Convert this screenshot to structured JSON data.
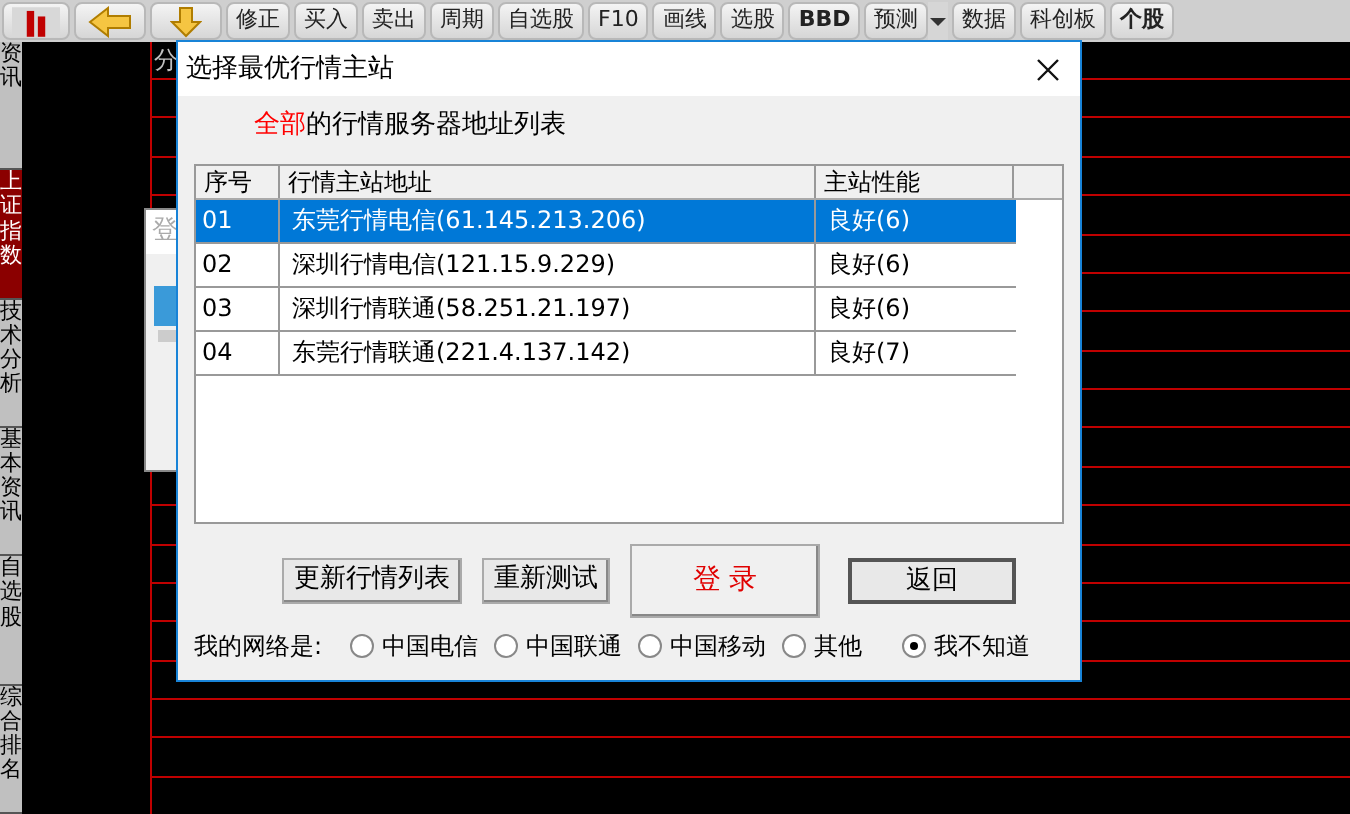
{
  "toolbar": [
    {
      "kind": "icon"
    },
    {
      "kind": "icon"
    },
    {
      "kind": "icon"
    },
    {
      "kind": "text",
      "label": "修正"
    },
    {
      "kind": "text",
      "label": "买入"
    },
    {
      "kind": "text",
      "label": "卖出"
    },
    {
      "kind": "text",
      "label": "周期"
    },
    {
      "kind": "text",
      "label": "自选股"
    },
    {
      "kind": "text",
      "label": "F10"
    },
    {
      "kind": "text",
      "label": "画线"
    },
    {
      "kind": "text",
      "label": "选股"
    },
    {
      "kind": "badge",
      "label": "BBD"
    },
    {
      "kind": "dropdown",
      "label": "预测"
    },
    {
      "kind": "text",
      "label": "数据"
    },
    {
      "kind": "text",
      "label": "科创板"
    },
    {
      "kind": "badge",
      "label": "个股"
    }
  ],
  "sidebar": [
    {
      "label": "资讯",
      "selected": false
    },
    {
      "label": "上证指数",
      "selected": true
    },
    {
      "label": "技术分析",
      "selected": false
    },
    {
      "label": "基本资讯",
      "selected": false
    },
    {
      "label": "自选股",
      "selected": false
    },
    {
      "label": "综合排名",
      "selected": false
    }
  ],
  "chart_header": "分",
  "background_dialog": {
    "title": "登"
  },
  "dialog": {
    "title": "选择最优行情主站",
    "heading": "**全部**的行情服务器地址列表",
    "columns": [
      "序号",
      "行情主站地址",
      "主站性能"
    ],
    "rows": [
      {
        "index": "01",
        "address": "东莞行情电信(61.145.213.206)",
        "performance": "良好(6)",
        "selected": true
      },
      {
        "index": "02",
        "address": "深圳行情电信(121.15.9.229)",
        "performance": "良好(6)",
        "selected": false
      },
      {
        "index": "03",
        "address": "深圳行情联通(58.251.21.197)",
        "performance": "良好(6)",
        "selected": false
      },
      {
        "index": "04",
        "address": "东莞行情联通(221.4.137.142)",
        "performance": "良好(7)",
        "selected": false
      }
    ],
    "buttons": [
      {
        "kind": "normal",
        "label": "更新行情列表"
      },
      {
        "kind": "normal",
        "label": "重新测试"
      },
      {
        "kind": "primary",
        "label": "登 录"
      },
      {
        "kind": "default",
        "label": "返回"
      }
    ],
    "network_label": "我的网络是:",
    "network_options": [
      {
        "label": "中国电信",
        "selected": false
      },
      {
        "label": "中国联通",
        "selected": false
      },
      {
        "label": "中国移动",
        "selected": false
      },
      {
        "label": "其他",
        "selected": false
      },
      {
        "label": "我不知道",
        "selected": true
      }
    ]
  }
}
